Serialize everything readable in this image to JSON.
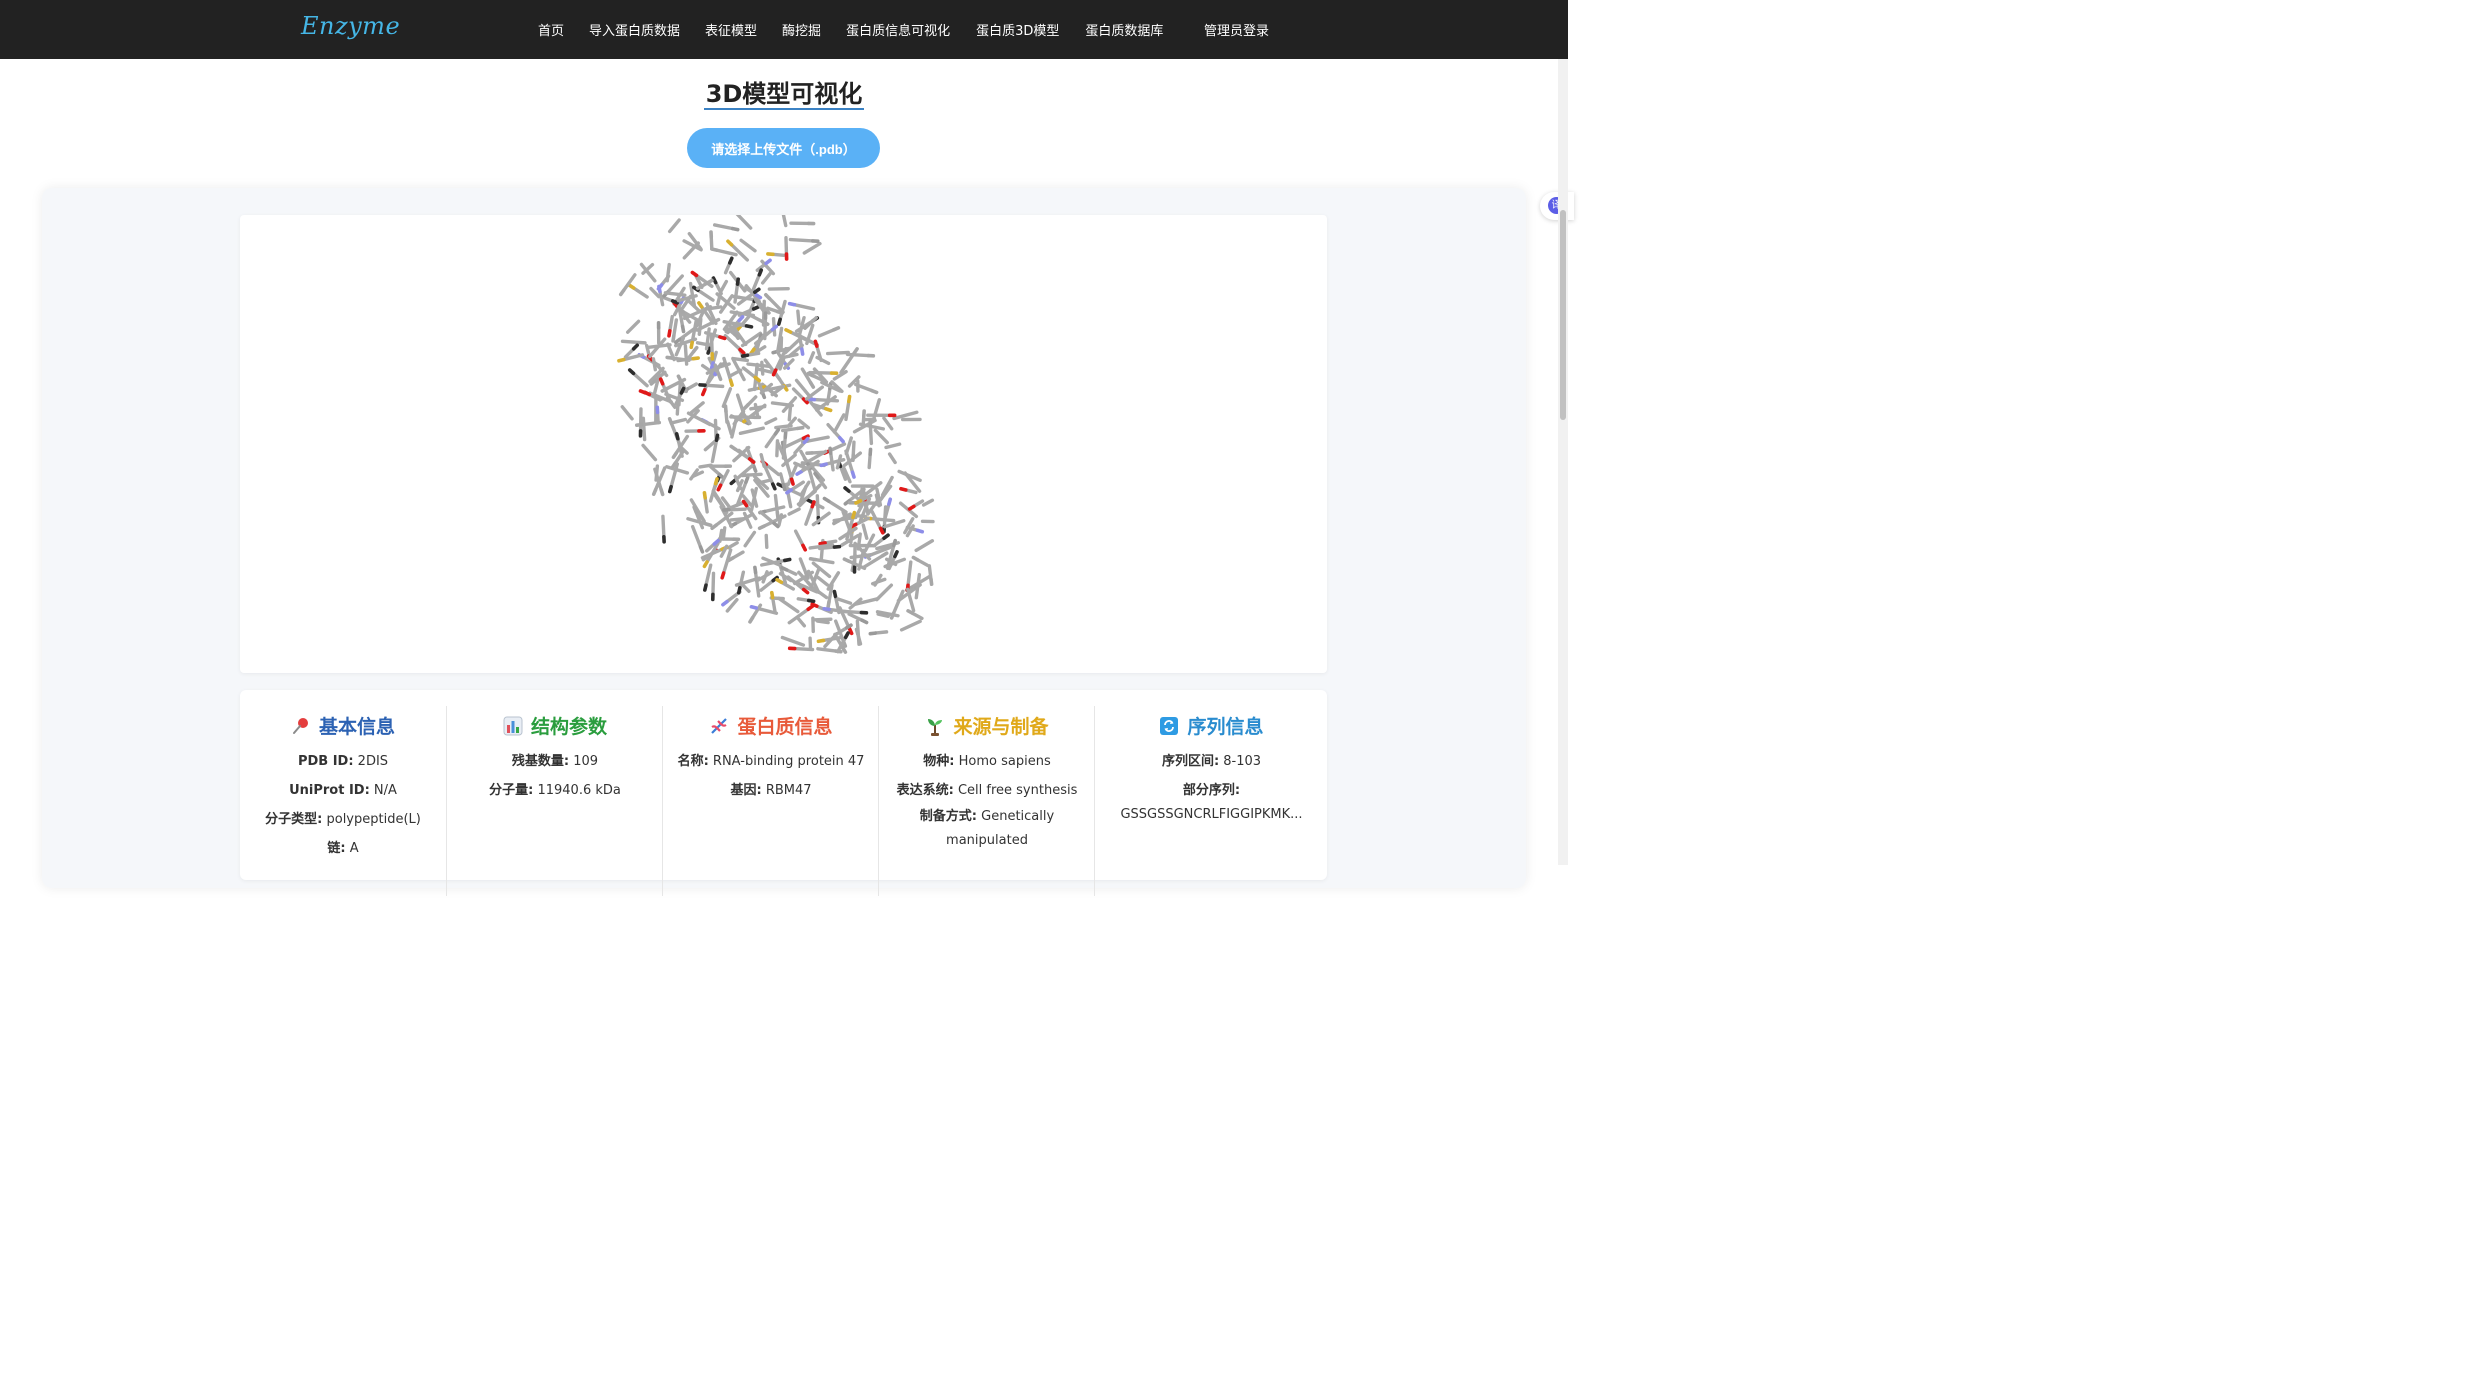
{
  "nav": {
    "brand": "Enzyme",
    "links": [
      "首页",
      "导入蛋白质数据",
      "表征模型",
      "酶挖掘",
      "蛋白质信息可视化",
      "蛋白质3D模型",
      "蛋白质数据库"
    ],
    "admin_login": "管理员登录"
  },
  "page": {
    "title": "3D模型可视化",
    "upload_label": "请选择上传文件（.pdb）"
  },
  "colors": {
    "nav_bg": "#222222",
    "brand": "#45b6e6",
    "accent": "#5ab1f6",
    "basic_info": "#2c62b3",
    "structure": "#2a9d3e",
    "protein": "#e85a3a",
    "source": "#e0a91a",
    "sequence": "#2a8ccf"
  },
  "info": {
    "basic": {
      "icon": "pin-icon",
      "title": "基本信息",
      "pdb_label": "PDB ID:",
      "pdb_value": "2DIS",
      "uniprot_label": "UniProt ID:",
      "uniprot_value": "N/A",
      "moltype_label": "分子类型:",
      "moltype_value": "polypeptide(L)",
      "chain_label": "链:",
      "chain_value": "A"
    },
    "structure": {
      "icon": "bar-chart-icon",
      "title": "结构参数",
      "residues_label": "残基数量:",
      "residues_value": "109",
      "mw_label": "分子量:",
      "mw_value": "11940.6 kDa"
    },
    "protein": {
      "icon": "dna-icon",
      "title": "蛋白质信息",
      "name_label": "名称:",
      "name_value": "RNA-binding protein 47",
      "gene_label": "基因:",
      "gene_value": "RBM47"
    },
    "source": {
      "icon": "seedling-icon",
      "title": "来源与制备",
      "species_label": "物种:",
      "species_value": "Homo sapiens",
      "expression_label": "表达系统:",
      "expression_value": "Cell free synthesis",
      "prep_label": "制备方式:",
      "prep_value": "Genetically manipulated"
    },
    "sequence": {
      "icon": "refresh-icon",
      "title": "序列信息",
      "range_label": "序列区间:",
      "range_value": "8-103",
      "partial_label": "部分序列:",
      "partial_value": "GSSGSSGNCRLFIGGIPKMK..."
    }
  },
  "translate_glyph": "译"
}
